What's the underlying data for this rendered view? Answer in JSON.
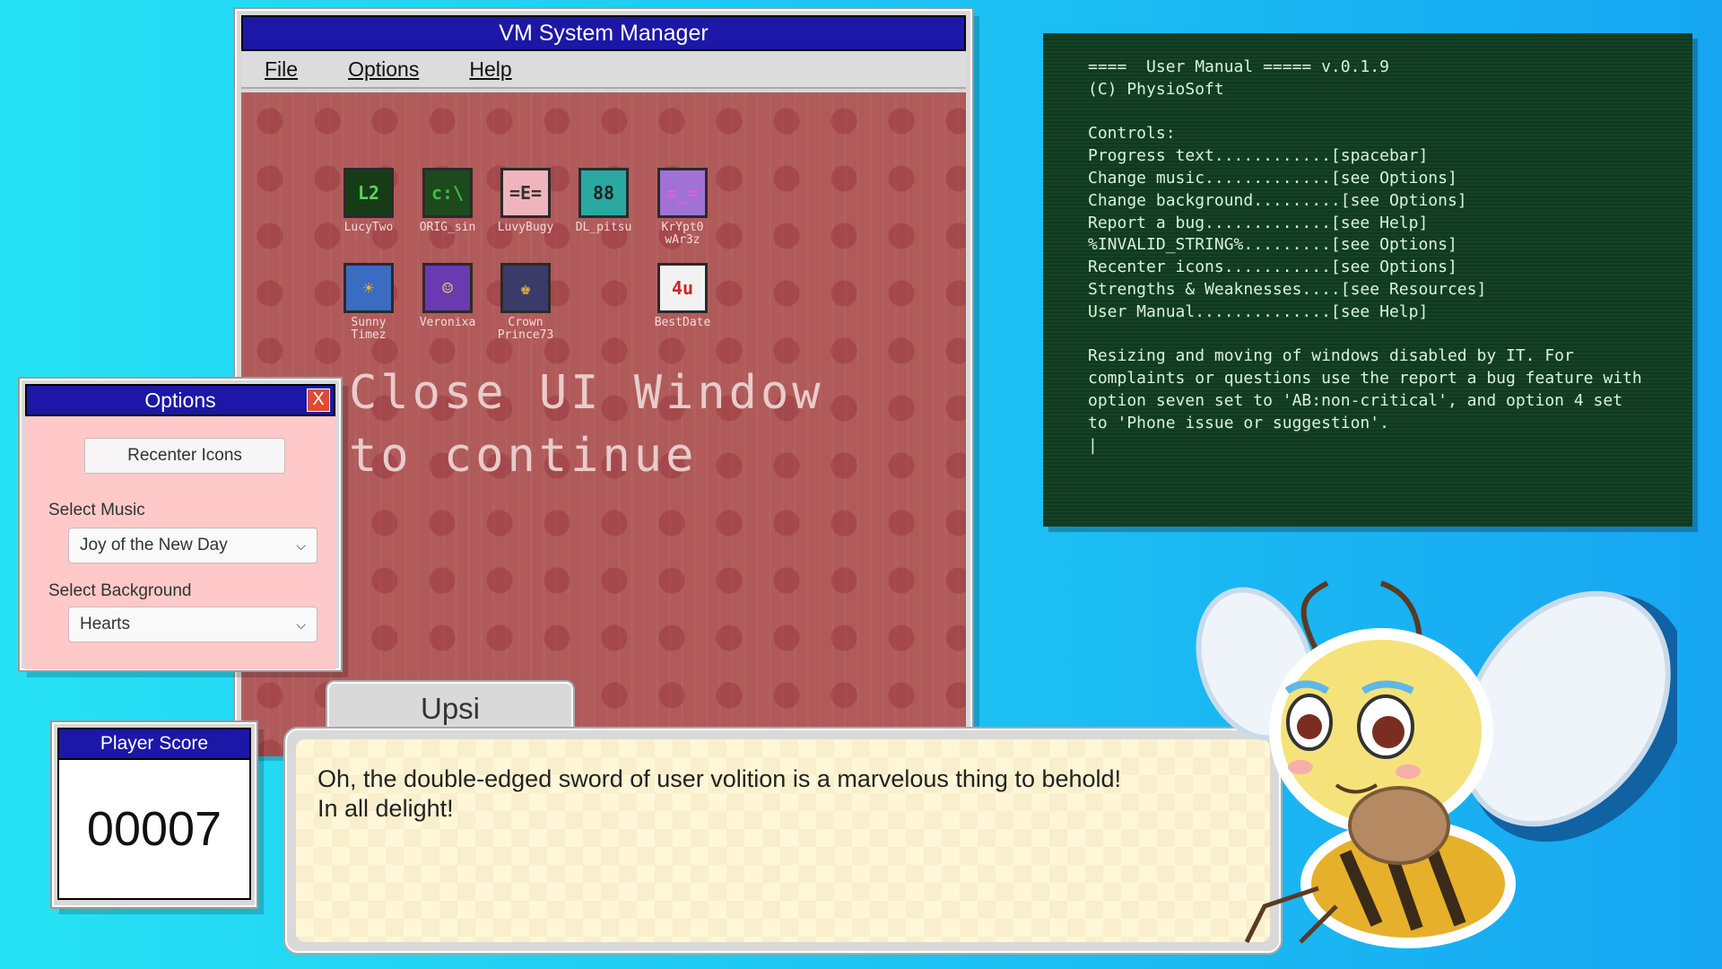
{
  "vm_window": {
    "title": "VM System Manager",
    "menu": [
      "File",
      "Options",
      "Help"
    ],
    "message": "Close UI Window\nto continue",
    "icons": [
      {
        "label": "LucyTwo",
        "bg": "#163c16",
        "fg": "#5bd45b",
        "glyph": "L2"
      },
      {
        "label": "ORIG_sin",
        "bg": "#1d4a1d",
        "fg": "#3fbf3f",
        "glyph": "c:\\"
      },
      {
        "label": "LuvyBugy",
        "bg": "#f0b4bc",
        "fg": "#333333",
        "glyph": "=E="
      },
      {
        "label": "DL_pitsu",
        "bg": "#2aa9a0",
        "fg": "#222222",
        "glyph": "88"
      },
      {
        "label": "KrYpt0 wAr3z",
        "bg": "#a072d6",
        "fg": "#e060d0",
        "glyph": "=_="
      },
      {
        "label": "Sunny Timez",
        "bg": "#3a6cc2",
        "fg": "#f2b518",
        "glyph": "☀"
      },
      {
        "label": "Veronixa",
        "bg": "#6a3ab0",
        "fg": "#f4d04a",
        "glyph": "☺"
      },
      {
        "label": "Crown Prince73",
        "bg": "#3b3b6a",
        "fg": "#e8b23a",
        "glyph": "♚"
      },
      {
        "label": "BestDate",
        "bg": "#f2f2f2",
        "fg": "#d22222",
        "glyph": "4u"
      }
    ]
  },
  "terminal": {
    "lines": [
      "====  User Manual ===== v.0.1.9",
      "(C) PhysioSoft",
      "",
      "Controls:",
      "Progress text............[spacebar]",
      "Change music.............[see Options]",
      "Change background.........[see Options]",
      "Report a bug.............[see Help]",
      "%INVALID_STRING%.........[see Options]",
      "Recenter icons...........[see Options]",
      "Strengths & Weaknesses....[see Resources]",
      "User Manual..............[see Help]",
      ""
    ],
    "paragraph": "Resizing and moving of windows disabled by IT. For complaints or questions use the report a bug feature with option seven set to 'AB:non-critical', and option 4 set to 'Phone issue or suggestion'.",
    "cursor": "|"
  },
  "options": {
    "title": "Options",
    "close": "X",
    "recenter_label": "Recenter Icons",
    "music_label": "Select Music",
    "music_value": "Joy of the New Day",
    "background_label": "Select Background",
    "background_value": "Hearts"
  },
  "score": {
    "title": "Player Score",
    "value": "00007"
  },
  "dialogue": {
    "speaker": "Upsi",
    "line1": "Oh, the double-edged sword of user volition is a marvelous thing to behold!",
    "line2": "In all delight!"
  },
  "colors": {
    "titlebar": "#1c17a6",
    "desktop": "#b05a5a",
    "terminal_bg": "#0e3a1f",
    "options_bg": "#ffc9c9",
    "dialogue_bg": "#fff7d8"
  }
}
